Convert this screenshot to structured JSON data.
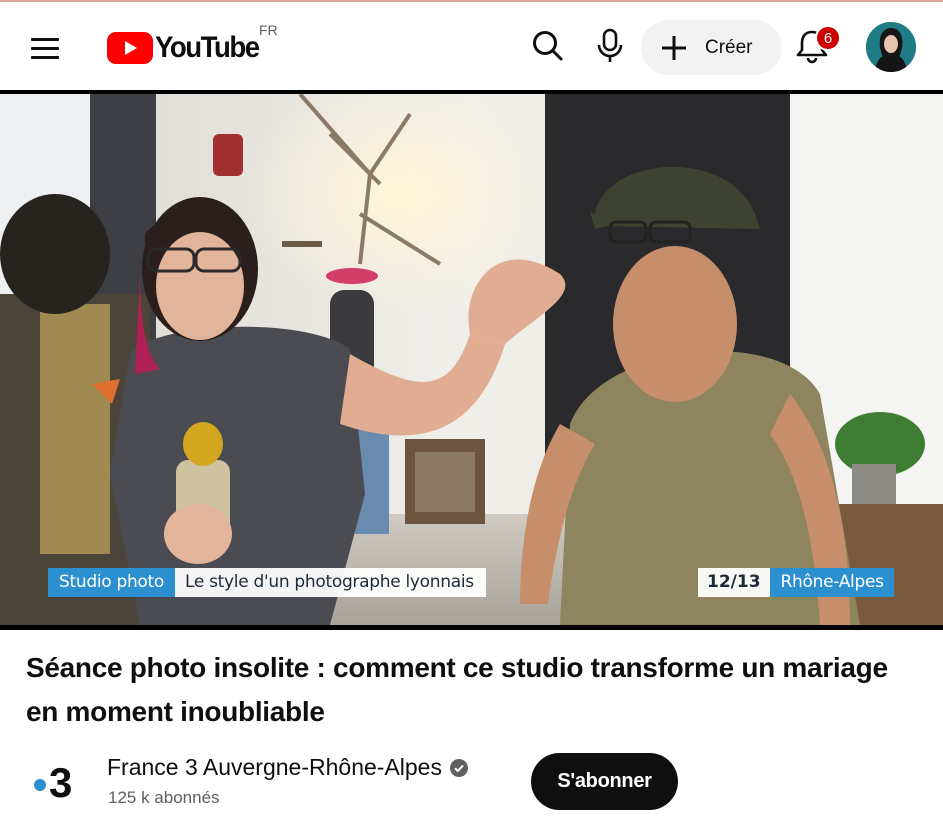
{
  "header": {
    "logo_text": "YouTube",
    "country_code": "FR",
    "create_label": "Créer",
    "notification_count": "6",
    "icons": [
      "menu-icon",
      "youtube-logo-icon",
      "search-icon",
      "microphone-icon",
      "plus-icon",
      "bell-icon"
    ]
  },
  "video": {
    "overlay_left_tag": "Studio photo",
    "overlay_left_text": "Le style d'un photographe lyonnais",
    "overlay_time": "12/13",
    "overlay_region": "Rhône-Alpes"
  },
  "title": "Séance photo insolite : comment ce studio transforme un mariage en moment inoubliable",
  "channel": {
    "name": "France 3 Auvergne-Rhône-Alpes",
    "subscribers": "125 k abonnés",
    "verified": true,
    "logo_text": "3"
  },
  "subscribe_label": "S'abonner",
  "colors": {
    "brand_red": "#ff0000",
    "badge_red": "#cc0000",
    "france3_blue": "#2c8fcf",
    "subscribe_bg": "#0f0f0f"
  }
}
